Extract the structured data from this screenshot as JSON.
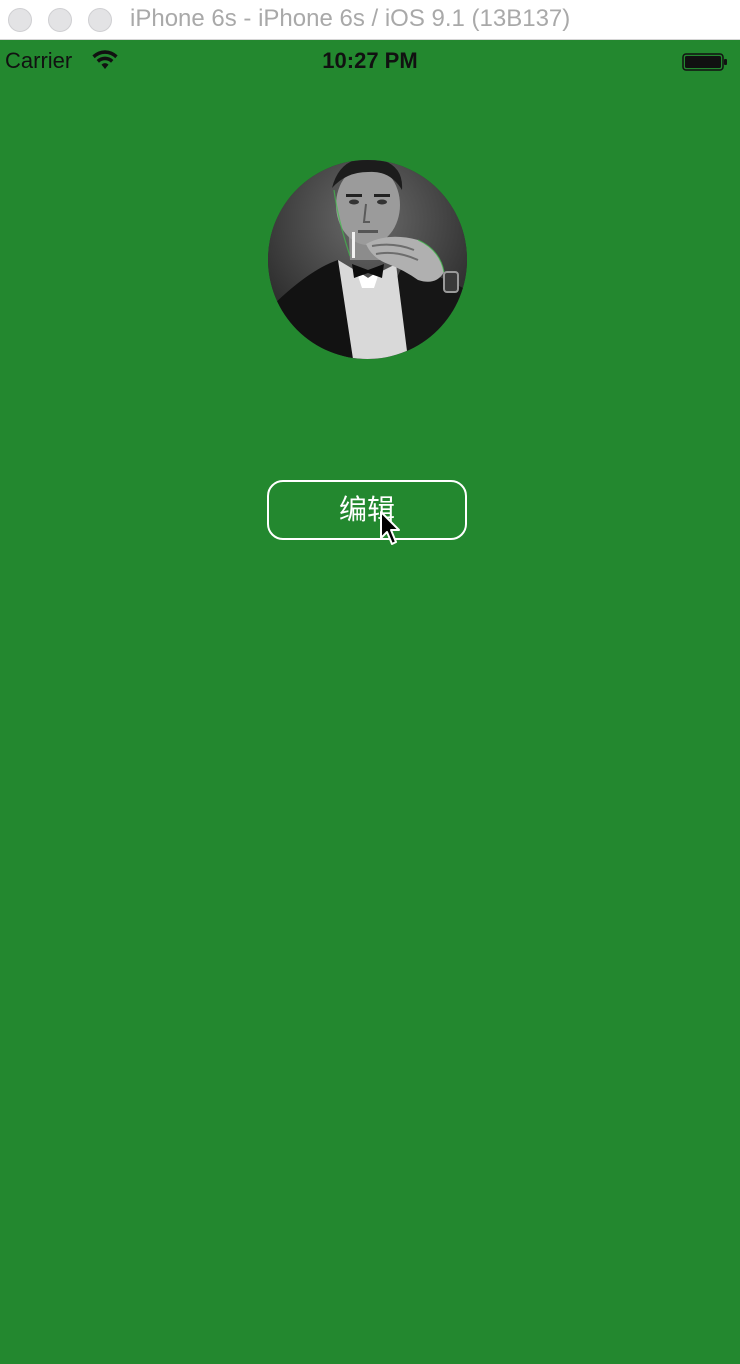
{
  "window": {
    "title": "iPhone 6s - iPhone 6s / iOS 9.1 (13B137)"
  },
  "status_bar": {
    "carrier": "Carrier",
    "time": "10:27 PM",
    "wifi_icon": "wifi-icon",
    "battery_icon": "battery-icon"
  },
  "profile": {
    "avatar_icon": "avatar-photo"
  },
  "edit_button": {
    "label": "编辑"
  },
  "colors": {
    "background": "#23882f",
    "button_border": "#ffffff",
    "button_text": "#ffffff"
  }
}
